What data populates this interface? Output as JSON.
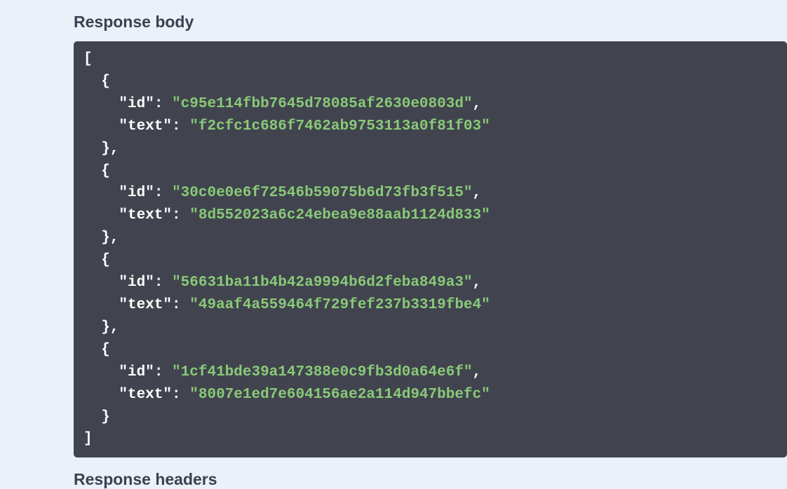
{
  "sections": {
    "response_body_title": "Response body",
    "response_headers_title": "Response headers"
  },
  "json_keys": {
    "id": "id",
    "text": "text"
  },
  "response_body": [
    {
      "id": "c95e114fbb7645d78085af2630e0803d",
      "text": "f2cfc1c686f7462ab9753113a0f81f03"
    },
    {
      "id": "30c0e0e6f72546b59075b6d73fb3f515",
      "text": "8d552023a6c24ebea9e88aab1124d833"
    },
    {
      "id": "56631ba11b4b42a9994b6d2feba849a3",
      "text": "49aaf4a559464f729fef237b3319fbe4"
    },
    {
      "id": "1cf41bde39a147388e0c9fb3d0a64e6f",
      "text": "8007e1ed7e604156ae2a114d947bbefc"
    }
  ]
}
